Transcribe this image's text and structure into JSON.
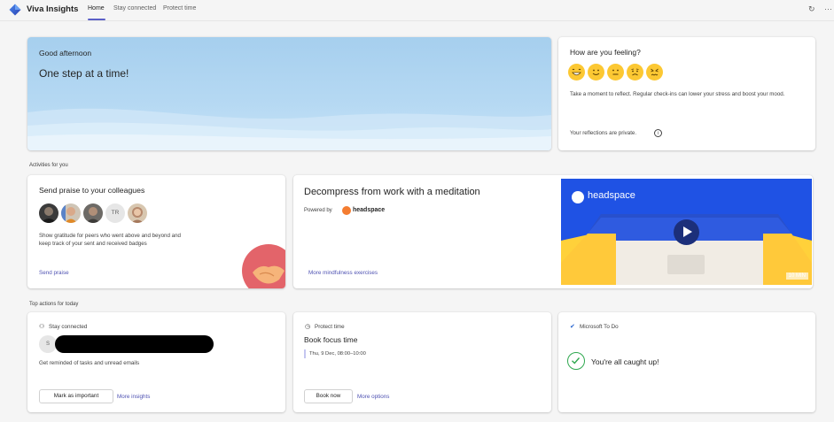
{
  "app": {
    "title": "Viva Insights"
  },
  "tabs": [
    {
      "label": "Home",
      "active": true
    },
    {
      "label": "Stay connected",
      "active": false
    },
    {
      "label": "Protect time",
      "active": false
    }
  ],
  "toolbar": {
    "refresh_icon": "refresh-icon",
    "more_icon": "more-icon"
  },
  "hero": {
    "greeting": "Good afternoon",
    "tagline": "One step at a time!"
  },
  "feeling": {
    "title": "How are you feeling?",
    "emojis": [
      "laughing-face",
      "smiling-face",
      "neutral-face",
      "sad-face",
      "angry-face"
    ],
    "description": "Take a moment to reflect. Regular check-ins can lower your stress and boost your mood.",
    "privacy_note": "Your reflections are private.",
    "info_glyph": "i"
  },
  "sections": {
    "activities": "Activities for you",
    "top_actions": "Top actions for today"
  },
  "praise": {
    "title": "Send praise to your colleagues",
    "avatar_initials": "TR",
    "description": "Show gratitude for peers who went above and beyond and keep track of your sent and received badges",
    "link": "Send praise"
  },
  "meditation": {
    "title": "Decompress from work with a meditation",
    "powered_by": "Powered by",
    "brand": "headspace",
    "link": "More mindfulness exercises",
    "video_brand": "headspace",
    "duration": "10 MIN"
  },
  "stay_connected": {
    "header": "Stay connected",
    "person_initial": "S",
    "description": "Get reminded of tasks and unread emails",
    "primary_button": "Mark as important",
    "secondary_link": "More insights"
  },
  "protect_time": {
    "header": "Protect time",
    "title": "Book focus time",
    "slot": "Thu, 9 Dec, 08:00–10:00",
    "primary_button": "Book now",
    "secondary_link": "More options"
  },
  "todo": {
    "header": "Microsoft To Do",
    "status": "You're all caught up!"
  },
  "colors": {
    "accent": "#5b5fc7",
    "link": "#4f52b2",
    "emoji": "#fcc833",
    "headspace_orange": "#f47d31",
    "headspace_blue": "#1f52e4",
    "success": "#2fa84f"
  }
}
